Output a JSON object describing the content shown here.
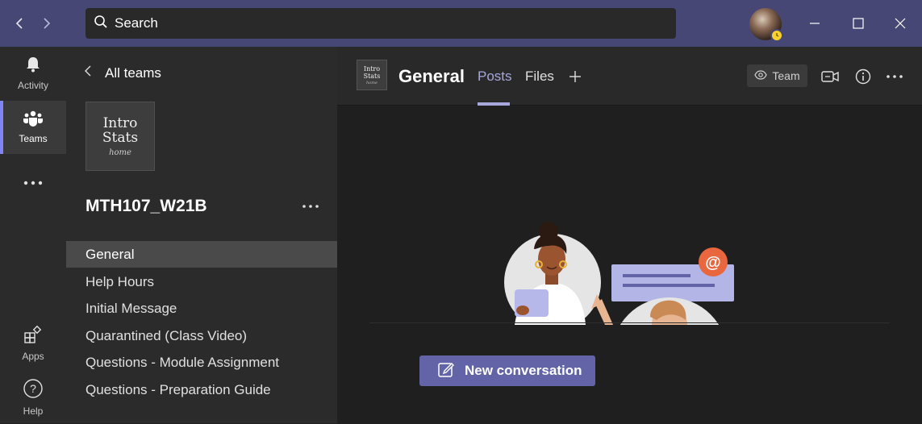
{
  "titlebar": {
    "search_label": "Search",
    "colors": {
      "bar": "#464775",
      "status": "#f8d22a"
    }
  },
  "rail": {
    "items": [
      {
        "label": "Activity",
        "icon": "bell-icon"
      },
      {
        "label": "Teams",
        "icon": "teams-icon",
        "active": true
      },
      {
        "label": "",
        "icon": "more-apps-icon"
      },
      {
        "label": "Apps",
        "icon": "apps-icon"
      },
      {
        "label": "Help",
        "icon": "help-icon"
      }
    ]
  },
  "panel": {
    "back_label": "All teams",
    "logo_line1": "Intro",
    "logo_line2": "Stats",
    "logo_line3": "home",
    "team_name": "MTH107_W21B",
    "channels": [
      {
        "label": "General",
        "active": true
      },
      {
        "label": "Help Hours"
      },
      {
        "label": "Initial Message"
      },
      {
        "label": "Quarantined (Class Video)"
      },
      {
        "label": "Questions - Module Assignment"
      },
      {
        "label": "Questions - Preparation Guide"
      }
    ]
  },
  "main": {
    "channel_title": "General",
    "tabs": [
      {
        "label": "Posts",
        "active": true
      },
      {
        "label": "Files"
      }
    ],
    "team_button": "Team",
    "new_conversation": "New conversation",
    "colors": {
      "accent": "#6264a7",
      "tab_active": "#a6a7dc"
    }
  }
}
